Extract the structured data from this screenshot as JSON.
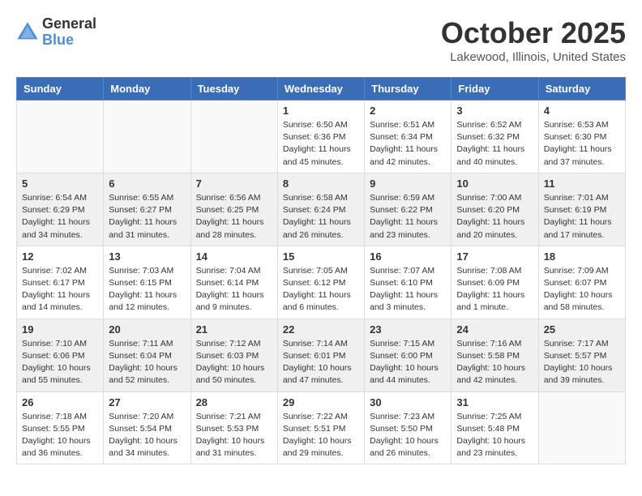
{
  "logo": {
    "general": "General",
    "blue": "Blue"
  },
  "title": "October 2025",
  "location": "Lakewood, Illinois, United States",
  "weekdays": [
    "Sunday",
    "Monday",
    "Tuesday",
    "Wednesday",
    "Thursday",
    "Friday",
    "Saturday"
  ],
  "weeks": [
    [
      {
        "day": "",
        "info": ""
      },
      {
        "day": "",
        "info": ""
      },
      {
        "day": "",
        "info": ""
      },
      {
        "day": "1",
        "info": "Sunrise: 6:50 AM\nSunset: 6:36 PM\nDaylight: 11 hours\nand 45 minutes."
      },
      {
        "day": "2",
        "info": "Sunrise: 6:51 AM\nSunset: 6:34 PM\nDaylight: 11 hours\nand 42 minutes."
      },
      {
        "day": "3",
        "info": "Sunrise: 6:52 AM\nSunset: 6:32 PM\nDaylight: 11 hours\nand 40 minutes."
      },
      {
        "day": "4",
        "info": "Sunrise: 6:53 AM\nSunset: 6:30 PM\nDaylight: 11 hours\nand 37 minutes."
      }
    ],
    [
      {
        "day": "5",
        "info": "Sunrise: 6:54 AM\nSunset: 6:29 PM\nDaylight: 11 hours\nand 34 minutes."
      },
      {
        "day": "6",
        "info": "Sunrise: 6:55 AM\nSunset: 6:27 PM\nDaylight: 11 hours\nand 31 minutes."
      },
      {
        "day": "7",
        "info": "Sunrise: 6:56 AM\nSunset: 6:25 PM\nDaylight: 11 hours\nand 28 minutes."
      },
      {
        "day": "8",
        "info": "Sunrise: 6:58 AM\nSunset: 6:24 PM\nDaylight: 11 hours\nand 26 minutes."
      },
      {
        "day": "9",
        "info": "Sunrise: 6:59 AM\nSunset: 6:22 PM\nDaylight: 11 hours\nand 23 minutes."
      },
      {
        "day": "10",
        "info": "Sunrise: 7:00 AM\nSunset: 6:20 PM\nDaylight: 11 hours\nand 20 minutes."
      },
      {
        "day": "11",
        "info": "Sunrise: 7:01 AM\nSunset: 6:19 PM\nDaylight: 11 hours\nand 17 minutes."
      }
    ],
    [
      {
        "day": "12",
        "info": "Sunrise: 7:02 AM\nSunset: 6:17 PM\nDaylight: 11 hours\nand 14 minutes."
      },
      {
        "day": "13",
        "info": "Sunrise: 7:03 AM\nSunset: 6:15 PM\nDaylight: 11 hours\nand 12 minutes."
      },
      {
        "day": "14",
        "info": "Sunrise: 7:04 AM\nSunset: 6:14 PM\nDaylight: 11 hours\nand 9 minutes."
      },
      {
        "day": "15",
        "info": "Sunrise: 7:05 AM\nSunset: 6:12 PM\nDaylight: 11 hours\nand 6 minutes."
      },
      {
        "day": "16",
        "info": "Sunrise: 7:07 AM\nSunset: 6:10 PM\nDaylight: 11 hours\nand 3 minutes."
      },
      {
        "day": "17",
        "info": "Sunrise: 7:08 AM\nSunset: 6:09 PM\nDaylight: 11 hours\nand 1 minute."
      },
      {
        "day": "18",
        "info": "Sunrise: 7:09 AM\nSunset: 6:07 PM\nDaylight: 10 hours\nand 58 minutes."
      }
    ],
    [
      {
        "day": "19",
        "info": "Sunrise: 7:10 AM\nSunset: 6:06 PM\nDaylight: 10 hours\nand 55 minutes."
      },
      {
        "day": "20",
        "info": "Sunrise: 7:11 AM\nSunset: 6:04 PM\nDaylight: 10 hours\nand 52 minutes."
      },
      {
        "day": "21",
        "info": "Sunrise: 7:12 AM\nSunset: 6:03 PM\nDaylight: 10 hours\nand 50 minutes."
      },
      {
        "day": "22",
        "info": "Sunrise: 7:14 AM\nSunset: 6:01 PM\nDaylight: 10 hours\nand 47 minutes."
      },
      {
        "day": "23",
        "info": "Sunrise: 7:15 AM\nSunset: 6:00 PM\nDaylight: 10 hours\nand 44 minutes."
      },
      {
        "day": "24",
        "info": "Sunrise: 7:16 AM\nSunset: 5:58 PM\nDaylight: 10 hours\nand 42 minutes."
      },
      {
        "day": "25",
        "info": "Sunrise: 7:17 AM\nSunset: 5:57 PM\nDaylight: 10 hours\nand 39 minutes."
      }
    ],
    [
      {
        "day": "26",
        "info": "Sunrise: 7:18 AM\nSunset: 5:55 PM\nDaylight: 10 hours\nand 36 minutes."
      },
      {
        "day": "27",
        "info": "Sunrise: 7:20 AM\nSunset: 5:54 PM\nDaylight: 10 hours\nand 34 minutes."
      },
      {
        "day": "28",
        "info": "Sunrise: 7:21 AM\nSunset: 5:53 PM\nDaylight: 10 hours\nand 31 minutes."
      },
      {
        "day": "29",
        "info": "Sunrise: 7:22 AM\nSunset: 5:51 PM\nDaylight: 10 hours\nand 29 minutes."
      },
      {
        "day": "30",
        "info": "Sunrise: 7:23 AM\nSunset: 5:50 PM\nDaylight: 10 hours\nand 26 minutes."
      },
      {
        "day": "31",
        "info": "Sunrise: 7:25 AM\nSunset: 5:48 PM\nDaylight: 10 hours\nand 23 minutes."
      },
      {
        "day": "",
        "info": ""
      }
    ]
  ]
}
